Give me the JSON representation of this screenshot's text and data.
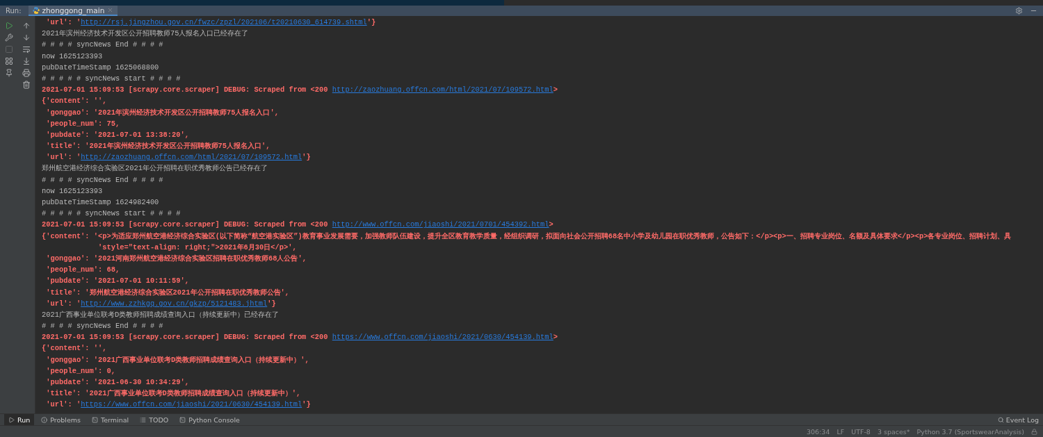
{
  "run_panel": {
    "label": "Run:",
    "tabs": [
      {
        "title": "zhonggong_main",
        "selected": true
      }
    ]
  },
  "console": {
    "lines": [
      {
        "kind": "stderr",
        "parts": [
          {
            "text": " 'url': '",
            "link": false
          },
          {
            "text": "http://rsj.jingzhou.gov.cn/fwzc/zpzl/202106/t20210630_614739.shtml",
            "link": true
          },
          {
            "text": "'}",
            "link": false
          }
        ]
      },
      {
        "kind": "stdout",
        "parts": [
          {
            "text": "2021年滨州经济技术开发区公开招聘教师75人报名入口已经存在了",
            "link": false
          }
        ]
      },
      {
        "kind": "stdout",
        "parts": [
          {
            "text": "# # # # syncNews End # # # #",
            "link": false
          }
        ]
      },
      {
        "kind": "stdout",
        "parts": [
          {
            "text": "now 1625123393",
            "link": false
          }
        ]
      },
      {
        "kind": "stdout",
        "parts": [
          {
            "text": "pubDateTimeStamp 1625068800",
            "link": false
          }
        ]
      },
      {
        "kind": "stdout",
        "parts": [
          {
            "text": "# # # # # syncNews start # # # #",
            "link": false
          }
        ]
      },
      {
        "kind": "stderr",
        "parts": [
          {
            "text": "2021-07-01 15:09:53 [scrapy.core.scraper] DEBUG: Scraped from <200 ",
            "link": false
          },
          {
            "text": "http://zaozhuang.offcn.com/html/2021/07/109572.html",
            "link": true
          },
          {
            "text": ">",
            "link": false
          }
        ]
      },
      {
        "kind": "stderr",
        "parts": [
          {
            "text": "{'content': '',",
            "link": false
          }
        ]
      },
      {
        "kind": "stderr",
        "parts": [
          {
            "text": " 'gonggao': '2021年滨州经济技术开发区公开招聘教师75人报名入口',",
            "link": false
          }
        ]
      },
      {
        "kind": "stderr",
        "parts": [
          {
            "text": " 'people_num': 75,",
            "link": false
          }
        ]
      },
      {
        "kind": "stderr",
        "parts": [
          {
            "text": " 'pubdate': '2021-07-01 13:38:20',",
            "link": false
          }
        ]
      },
      {
        "kind": "stderr",
        "parts": [
          {
            "text": " 'title': '2021年滨州经济技术开发区公开招聘教师75人报名入口',",
            "link": false
          }
        ]
      },
      {
        "kind": "stderr",
        "parts": [
          {
            "text": " 'url': '",
            "link": false
          },
          {
            "text": "http://zaozhuang.offcn.com/html/2021/07/109572.html",
            "link": true
          },
          {
            "text": "'}",
            "link": false
          }
        ]
      },
      {
        "kind": "stdout",
        "parts": [
          {
            "text": "郑州航空港经济综合实验区2021年公开招聘在职优秀教师公告已经存在了",
            "link": false
          }
        ]
      },
      {
        "kind": "stdout",
        "parts": [
          {
            "text": "# # # # syncNews End # # # #",
            "link": false
          }
        ]
      },
      {
        "kind": "stdout",
        "parts": [
          {
            "text": "now 1625123393",
            "link": false
          }
        ]
      },
      {
        "kind": "stdout",
        "parts": [
          {
            "text": "pubDateTimeStamp 1624982400",
            "link": false
          }
        ]
      },
      {
        "kind": "stdout",
        "parts": [
          {
            "text": "# # # # # syncNews start # # # #",
            "link": false
          }
        ]
      },
      {
        "kind": "stderr",
        "parts": [
          {
            "text": "2021-07-01 15:09:53 [scrapy.core.scraper] DEBUG: Scraped from <200 ",
            "link": false
          },
          {
            "text": "http://www.offcn.com/jiaoshi/2021/0701/454392.html",
            "link": true
          },
          {
            "text": ">",
            "link": false
          }
        ]
      },
      {
        "kind": "stderr",
        "parts": [
          {
            "text": "{'content': '<p>为适应郑州航空港经济综合实验区(以下简称“航空港实验区”)教育事业发展需要，加强教师队伍建设，提升全区教育教学质量，经组织调研，拟面向社会公开招聘68名中小学及幼儿园在职优秀教师，公告如下：</p><p>一、招聘专业岗位、名额及具体要求</p><p>各专业岗位、招聘计划、具",
            "link": false
          }
        ]
      },
      {
        "kind": "stderr",
        "parts": [
          {
            "text": "             'style=\"text-align: right;\">2021年6月30日</p>',",
            "link": false
          }
        ]
      },
      {
        "kind": "stderr",
        "parts": [
          {
            "text": " 'gonggao': '2021河南郑州航空港经济综合实验区招聘在职优秀教师68人公告',",
            "link": false
          }
        ]
      },
      {
        "kind": "stderr",
        "parts": [
          {
            "text": " 'people_num': 68,",
            "link": false
          }
        ]
      },
      {
        "kind": "stderr",
        "parts": [
          {
            "text": " 'pubdate': '2021-07-01 10:11:59',",
            "link": false
          }
        ]
      },
      {
        "kind": "stderr",
        "parts": [
          {
            "text": " 'title': '郑州航空港经济综合实验区2021年公开招聘在职优秀教师公告',",
            "link": false
          }
        ]
      },
      {
        "kind": "stderr",
        "parts": [
          {
            "text": " 'url': '",
            "link": false
          },
          {
            "text": "http://www.zzhkgq.gov.cn/gkzp/5121483.jhtml",
            "link": true
          },
          {
            "text": "'}",
            "link": false
          }
        ]
      },
      {
        "kind": "stdout",
        "parts": [
          {
            "text": "2021广西事业单位联考D类教师招聘成绩查询入口（持续更新中）已经存在了",
            "link": false
          }
        ]
      },
      {
        "kind": "stdout",
        "parts": [
          {
            "text": "# # # # syncNews End # # # #",
            "link": false
          }
        ]
      },
      {
        "kind": "stderr",
        "parts": [
          {
            "text": "2021-07-01 15:09:53 [scrapy.core.scraper] DEBUG: Scraped from <200 ",
            "link": false
          },
          {
            "text": "https://www.offcn.com/jiaoshi/2021/0630/454139.html",
            "link": true
          },
          {
            "text": ">",
            "link": false
          }
        ]
      },
      {
        "kind": "stderr",
        "parts": [
          {
            "text": "{'content': '',",
            "link": false
          }
        ]
      },
      {
        "kind": "stderr",
        "parts": [
          {
            "text": " 'gonggao': '2021广西事业单位联考D类教师招聘成绩查询入口（持续更新中）',",
            "link": false
          }
        ]
      },
      {
        "kind": "stderr",
        "parts": [
          {
            "text": " 'people_num': 0,",
            "link": false
          }
        ]
      },
      {
        "kind": "stderr",
        "parts": [
          {
            "text": " 'pubdate': '2021-06-30 10:34:29',",
            "link": false
          }
        ]
      },
      {
        "kind": "stderr",
        "parts": [
          {
            "text": " 'title': '2021广西事业单位联考D类教师招聘成绩查询入口（持续更新中）',",
            "link": false
          }
        ]
      },
      {
        "kind": "stderr",
        "parts": [
          {
            "text": " 'url': '",
            "link": false
          },
          {
            "text": "https://www.offcn.com/jiaoshi/2021/0630/454139.html",
            "link": true
          },
          {
            "text": "'}",
            "link": false
          }
        ]
      }
    ]
  },
  "tool_windows": [
    {
      "label": "Run",
      "kind": "run",
      "selected": true
    },
    {
      "label": "Problems",
      "kind": "problems",
      "selected": false
    },
    {
      "label": "Terminal",
      "kind": "terminal",
      "selected": false
    },
    {
      "label": "TODO",
      "kind": "todo",
      "selected": false
    },
    {
      "label": "Python Console",
      "kind": "python",
      "selected": false
    }
  ],
  "event_log": "Event Log",
  "status_bar": [
    "306:34",
    "LF",
    "UTF-8",
    "3 spaces*",
    "Python 3.7 (SportswearAnalysis)"
  ]
}
